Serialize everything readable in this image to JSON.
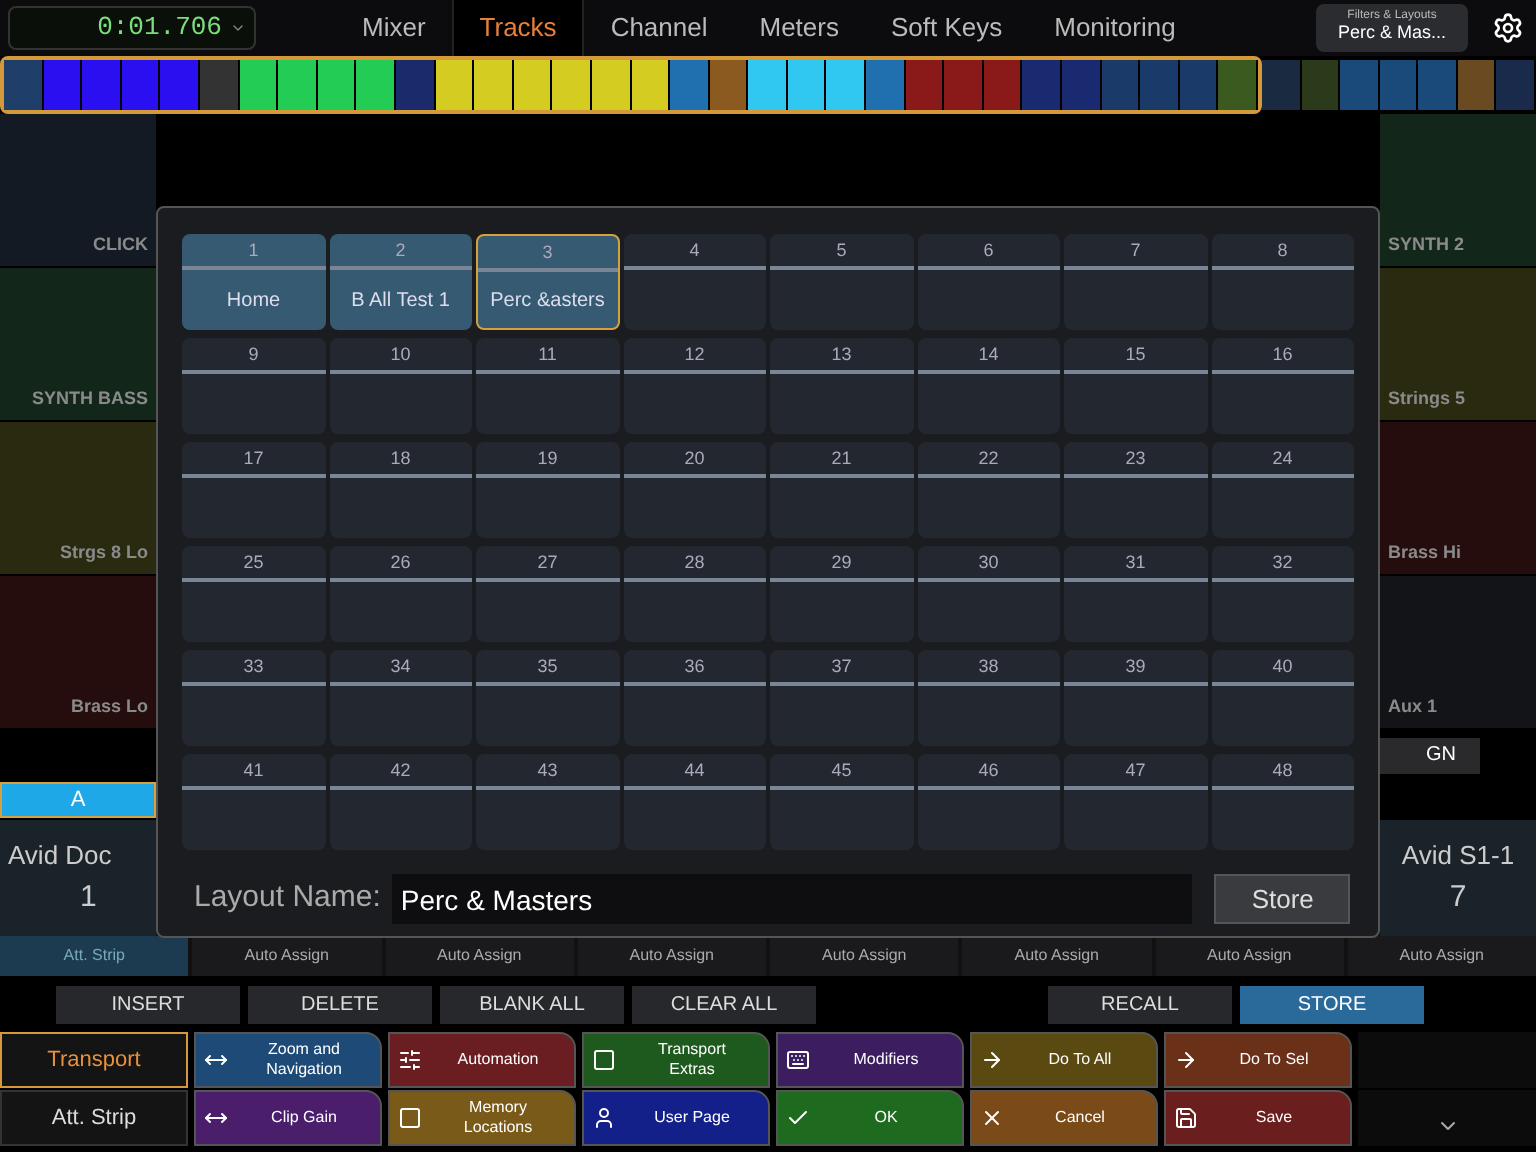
{
  "top_bar": {
    "timecode": "0:01.706",
    "tabs": [
      {
        "label": "Mixer",
        "selected": false
      },
      {
        "label": "Tracks",
        "selected": true
      },
      {
        "label": "Channel",
        "selected": false
      },
      {
        "label": "Meters",
        "selected": false
      },
      {
        "label": "Soft Keys",
        "selected": false
      },
      {
        "label": "Monitoring",
        "selected": false
      }
    ],
    "filters_label": "Filters & Layouts",
    "filters_value": "Perc & Mas..."
  },
  "track_strip": {
    "in_view": [
      {
        "color": "#1f3f6a"
      },
      {
        "color": "#2a10f0"
      },
      {
        "color": "#2a10f0"
      },
      {
        "color": "#2a10f0"
      },
      {
        "color": "#2a10f0"
      },
      {
        "color": "#333333"
      },
      {
        "color": "#22cc55"
      },
      {
        "color": "#22cc55"
      },
      {
        "color": "#22cc55"
      },
      {
        "color": "#22cc55"
      },
      {
        "color": "#1a2a6a"
      },
      {
        "color": "#d4cc20"
      },
      {
        "color": "#d4cc20"
      },
      {
        "color": "#d4cc20"
      },
      {
        "color": "#d4cc20"
      },
      {
        "color": "#d4cc20"
      },
      {
        "color": "#d4cc20"
      },
      {
        "color": "#2070b0"
      },
      {
        "color": "#8a5a20"
      },
      {
        "color": "#30c8f0"
      },
      {
        "color": "#30c8f0"
      },
      {
        "color": "#30c8f0"
      },
      {
        "color": "#2070b0"
      },
      {
        "color": "#8a1a1a"
      },
      {
        "color": "#8a1a1a"
      },
      {
        "color": "#8a1a1a"
      },
      {
        "color": "#1a2a70"
      },
      {
        "color": "#1a2a70"
      },
      {
        "color": "#1a3a6a"
      },
      {
        "color": "#1a3a6a"
      },
      {
        "color": "#1a3a6a"
      },
      {
        "color": "#3a5a20"
      }
    ],
    "out_of_view": [
      {
        "color": "#1a2a40"
      },
      {
        "color": "#2a3a1a"
      },
      {
        "color": "#1a4a7a"
      },
      {
        "color": "#1a4a7a"
      },
      {
        "color": "#1a4a7a"
      },
      {
        "color": "#6a4a20"
      },
      {
        "color": "#1a2a4a"
      }
    ]
  },
  "tracks_left": [
    {
      "name": "CLICK",
      "color": "#141a24"
    },
    {
      "name": "SYNTH BASS",
      "color": "#13261a"
    },
    {
      "name": "Strgs 8 Lo",
      "color": "#2a2a10"
    },
    {
      "name": "Brass Lo",
      "color": "#260d0d"
    }
  ],
  "tracks_right": [
    {
      "name": "SYNTH 2",
      "color": "#13261a"
    },
    {
      "name": "Strings 5",
      "color": "#2a2a10"
    },
    {
      "name": "Brass Hi",
      "color": "#260d0d"
    },
    {
      "name": "Aux 1",
      "color": "#121418"
    }
  ],
  "assign_button": "GN",
  "bank_label": "A",
  "channel_left": {
    "name": "Avid Doc",
    "number": "1"
  },
  "channel_right": {
    "name": "Avid S1-1",
    "number": "7"
  },
  "assign_row": [
    {
      "label": "Att. Strip",
      "selected": true
    },
    {
      "label": "Auto Assign",
      "selected": false
    },
    {
      "label": "Auto Assign",
      "selected": false
    },
    {
      "label": "Auto Assign",
      "selected": false
    },
    {
      "label": "Auto Assign",
      "selected": false
    },
    {
      "label": "Auto Assign",
      "selected": false
    },
    {
      "label": "Auto Assign",
      "selected": false
    },
    {
      "label": "Auto Assign",
      "selected": false
    }
  ],
  "edit_buttons": [
    {
      "label": "INSERT",
      "selected": false
    },
    {
      "label": "DELETE",
      "selected": false
    },
    {
      "label": "BLANK ALL",
      "selected": false
    },
    {
      "label": "CLEAR ALL",
      "selected": false
    }
  ],
  "store_buttons": [
    {
      "label": "RECALL",
      "selected": false
    },
    {
      "label": "STORE",
      "selected": true
    }
  ],
  "softkey_rows": [
    {
      "tab": {
        "label": "Transport",
        "selected": true
      },
      "keys": [
        {
          "label": "Zoom and Navigation",
          "color": "#1e4a78"
        },
        {
          "label": "Automation",
          "color": "#6a1e22"
        },
        {
          "label": "Transport Extras",
          "color": "#1e5a1e"
        },
        {
          "label": "Modifiers",
          "color": "#3c1e60"
        },
        {
          "label": "Do To All",
          "color": "#5a4a12"
        },
        {
          "label": "Do To Sel",
          "color": "#6a3018"
        }
      ]
    },
    {
      "tab": {
        "label": "Att. Strip",
        "selected": false
      },
      "keys": [
        {
          "label": "Clip Gain",
          "color": "#4a1e6a"
        },
        {
          "label": "Memory Locations",
          "color": "#7a5a18"
        },
        {
          "label": "User Page",
          "color": "#14208a"
        },
        {
          "label": "OK",
          "color": "#1e6a1e"
        },
        {
          "label": "Cancel",
          "color": "#7a4a18"
        },
        {
          "label": "Save",
          "color": "#6a1e1e"
        }
      ]
    }
  ],
  "dialog": {
    "slots": [
      {
        "number": "1",
        "name": "Home",
        "selected": false
      },
      {
        "number": "2",
        "name": "B All Test 1",
        "selected": false
      },
      {
        "number": "3",
        "name": "Perc &asters",
        "selected": true
      },
      {
        "number": "4"
      },
      {
        "number": "5"
      },
      {
        "number": "6"
      },
      {
        "number": "7"
      },
      {
        "number": "8"
      },
      {
        "number": "9"
      },
      {
        "number": "10"
      },
      {
        "number": "11"
      },
      {
        "number": "12"
      },
      {
        "number": "13"
      },
      {
        "number": "14"
      },
      {
        "number": "15"
      },
      {
        "number": "16"
      },
      {
        "number": "17"
      },
      {
        "number": "18"
      },
      {
        "number": "19"
      },
      {
        "number": "20"
      },
      {
        "number": "21"
      },
      {
        "number": "22"
      },
      {
        "number": "23"
      },
      {
        "number": "24"
      },
      {
        "number": "25"
      },
      {
        "number": "26"
      },
      {
        "number": "27"
      },
      {
        "number": "28"
      },
      {
        "number": "29"
      },
      {
        "number": "30"
      },
      {
        "number": "31"
      },
      {
        "number": "32"
      },
      {
        "number": "33"
      },
      {
        "number": "34"
      },
      {
        "number": "35"
      },
      {
        "number": "36"
      },
      {
        "number": "37"
      },
      {
        "number": "38"
      },
      {
        "number": "39"
      },
      {
        "number": "40"
      },
      {
        "number": "41"
      },
      {
        "number": "42"
      },
      {
        "number": "43"
      },
      {
        "number": "44"
      },
      {
        "number": "45"
      },
      {
        "number": "46"
      },
      {
        "number": "47"
      },
      {
        "number": "48"
      }
    ],
    "name_label": "Layout Name:",
    "name_value": "Perc & Masters",
    "store": "Store"
  }
}
